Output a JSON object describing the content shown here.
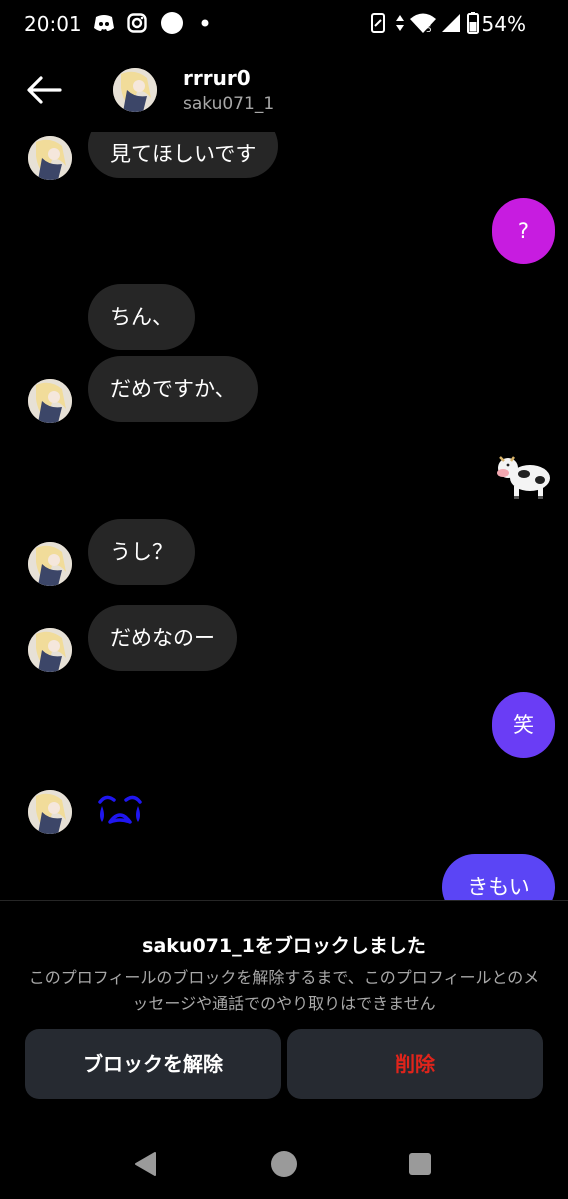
{
  "status_bar": {
    "time": "20:01",
    "battery_percent": "54%",
    "icons": [
      "discord-icon",
      "instagram-icon",
      "circle-notification-icon",
      "dot-icon",
      "vibrate-icon",
      "data-arrows-icon",
      "wifi-icon",
      "signal-icon",
      "battery-icon"
    ]
  },
  "header": {
    "display_name": "rrrur0",
    "username": "saku071_1"
  },
  "messages": [
    {
      "from": "them",
      "text": "見てほしいです"
    },
    {
      "from": "me",
      "text": "?"
    },
    {
      "from": "them",
      "text": "ちん、"
    },
    {
      "from": "them",
      "text": "だめですか、"
    },
    {
      "from": "me",
      "text": "🐄",
      "kind": "emoji"
    },
    {
      "from": "them",
      "text": "うし？"
    },
    {
      "from": "them",
      "text": "だめなのー"
    },
    {
      "from": "me",
      "text": "笑"
    },
    {
      "from": "them",
      "text": "😭",
      "kind": "emoji"
    },
    {
      "from": "me",
      "text": "きもい"
    }
  ],
  "block_panel": {
    "title": "saku071_1をブロックしました",
    "description": "このプロフィールのブロックを解除するまで、このプロフィールとのメッセージや通話でのやり取りはできません",
    "unblock_label": "ブロックを解除",
    "delete_label": "削除"
  },
  "colors": {
    "background": "#000000",
    "received_bubble": "#262626",
    "sent_magenta": "#c71ce0",
    "sent_purple": "#6a3df5",
    "sent_indigo": "#5b45f5",
    "delete_red": "#e0241b",
    "button_bg": "#262a31"
  },
  "nav_bar": {
    "icons": [
      "back-triangle-icon",
      "home-circle-icon",
      "recents-square-icon"
    ]
  }
}
